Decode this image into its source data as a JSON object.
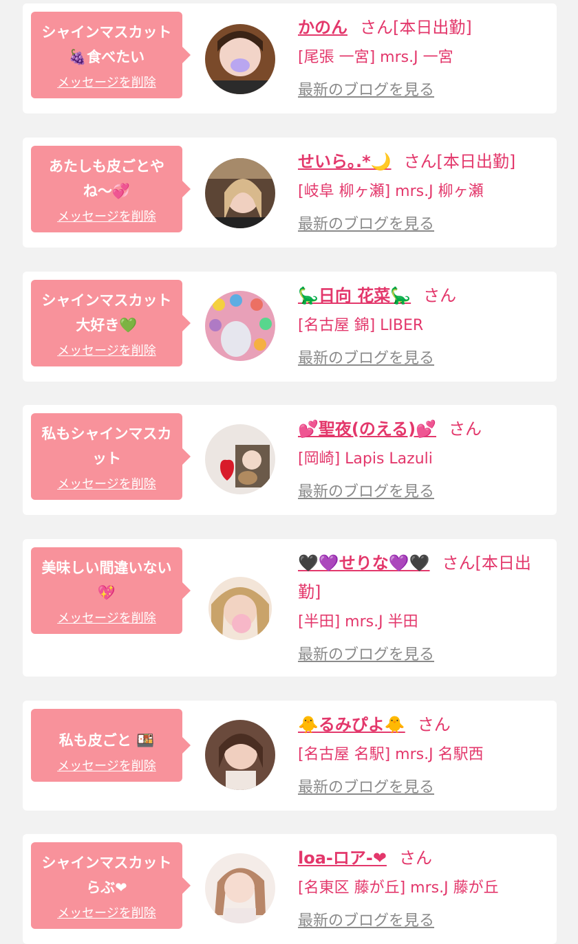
{
  "cards": [
    {
      "message": "シャインマスカット🍇食べたい",
      "delete_label": "メッセージを削除",
      "name": "かのん",
      "suffix": "さん[本日出勤]",
      "shop": "[尾張 一宮] mrs.J 一宮",
      "blog_label": "最新のブログを見る"
    },
    {
      "message": "あたしも皮ごとやね〜💞",
      "delete_label": "メッセージを削除",
      "name": "せいら｡.*🌙",
      "suffix": "さん[本日出勤]",
      "shop": "[岐阜 柳ヶ瀬] mrs.J 柳ヶ瀬",
      "blog_label": "最新のブログを見る"
    },
    {
      "message": "シャインマスカット大好き💚",
      "delete_label": "メッセージを削除",
      "name": "🦕日向 花菜🦕",
      "suffix": "さん",
      "shop": "[名古屋 錦] LIBER",
      "blog_label": "最新のブログを見る"
    },
    {
      "message": "私もシャインマスカット",
      "delete_label": "メッセージを削除",
      "name": "💕聖夜(のえる)💕",
      "suffix": "さん",
      "shop": "[岡崎] Lapis Lazuli",
      "blog_label": "最新のブログを見る"
    },
    {
      "message": "美味しい間違いない💖",
      "delete_label": "メッセージを削除",
      "name": "🖤💜せりな💜🖤",
      "suffix": "さん[本日出勤]",
      "shop": "[半田] mrs.J 半田",
      "blog_label": "最新のブログを見る"
    },
    {
      "message": "私も皮ごと 🍱",
      "delete_label": "メッセージを削除",
      "name": "🐥るみぴよ🐥",
      "suffix": "さん",
      "shop": "[名古屋 名駅] mrs.J 名駅西",
      "blog_label": "最新のブログを見る"
    },
    {
      "message": "シャインマスカットらぶ❤",
      "delete_label": "メッセージを削除",
      "name": "loa-ロア-❤",
      "suffix": "さん",
      "shop": "[名東区 藤が丘] mrs.J 藤が丘",
      "blog_label": "最新のブログを見る"
    }
  ],
  "colors": {
    "page_background": "#f2f2f2",
    "card_background": "#ffffff",
    "bubble_pink": "#f8929b",
    "name_pink": "#e3376b",
    "link_gray": "#8a8a8a"
  }
}
